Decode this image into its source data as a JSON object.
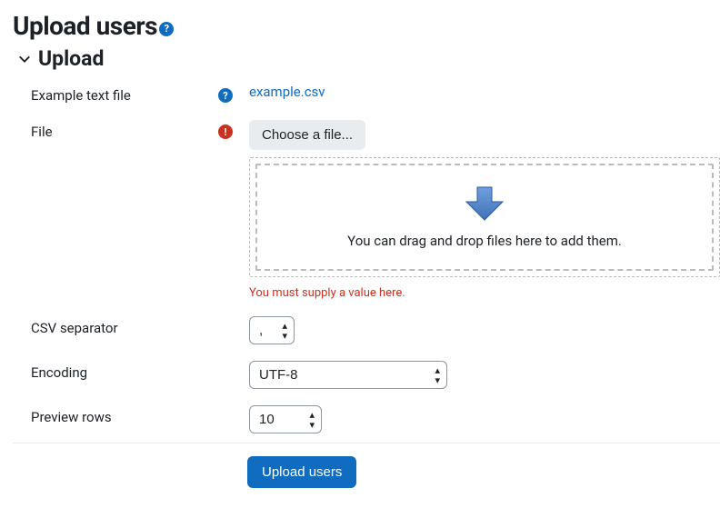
{
  "page": {
    "title": "Upload users",
    "section_title": "Upload"
  },
  "fields": {
    "example": {
      "label": "Example text file",
      "link_text": "example.csv"
    },
    "file": {
      "label": "File",
      "button_label": "Choose a file...",
      "dropzone_text": "You can drag and drop files here to add them.",
      "error": "You must supply a value here."
    },
    "csv_separator": {
      "label": "CSV separator",
      "value": ","
    },
    "encoding": {
      "label": "Encoding",
      "value": "UTF-8"
    },
    "preview_rows": {
      "label": "Preview rows",
      "value": "10"
    }
  },
  "submit": {
    "label": "Upload users"
  }
}
